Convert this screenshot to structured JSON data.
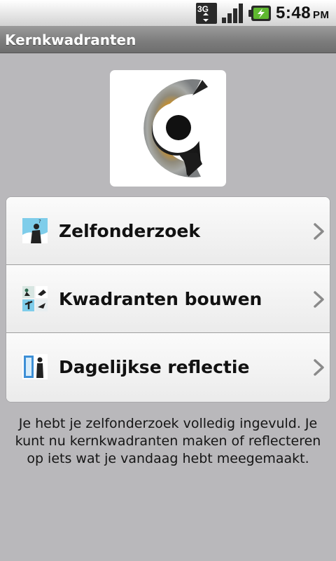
{
  "status_bar": {
    "network": "3G",
    "time": "5:48",
    "ampm": "PM"
  },
  "app": {
    "title": "Kernkwadranten"
  },
  "menu": {
    "items": [
      {
        "label": "Zelfonderzoek",
        "icon": "self-research-icon"
      },
      {
        "label": "Kwadranten bouwen",
        "icon": "quadrants-icon"
      },
      {
        "label": "Dagelijkse reflectie",
        "icon": "reflection-icon"
      }
    ]
  },
  "info_text": "Je hebt je zelfonderzoek volledig ingevuld. Je kunt nu kernkwadranten maken of reflecteren op iets wat je vandaag hebt meegemaakt.",
  "colors": {
    "background": "#b9b8bb",
    "title_bar": "#7d7d7d",
    "menu_item": "#f3f3f3",
    "text": "#111111"
  }
}
